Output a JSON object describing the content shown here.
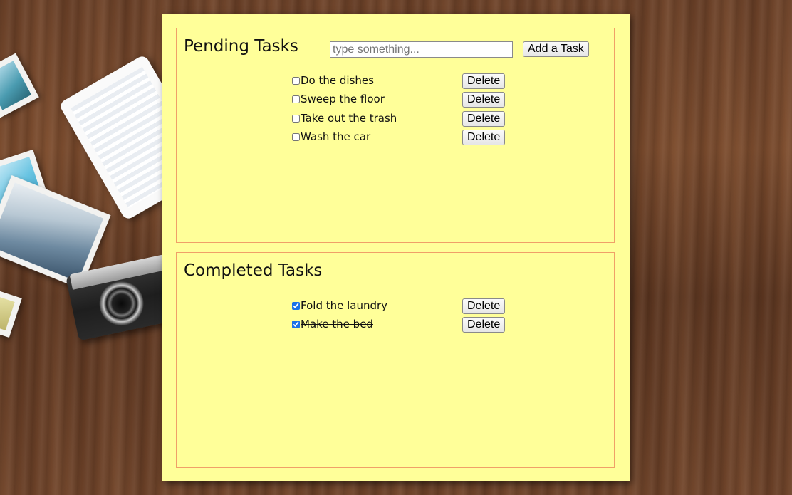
{
  "pending": {
    "title": "Pending Tasks",
    "input_placeholder": "type something...",
    "input_value": "",
    "add_button_label": "Add a Task",
    "tasks": [
      {
        "label": "Do the dishes",
        "checked": false,
        "delete_label": "Delete"
      },
      {
        "label": "Sweep the floor",
        "checked": false,
        "delete_label": "Delete"
      },
      {
        "label": "Take out the trash",
        "checked": false,
        "delete_label": "Delete"
      },
      {
        "label": "Wash the car",
        "checked": false,
        "delete_label": "Delete"
      }
    ]
  },
  "completed": {
    "title": "Completed Tasks",
    "tasks": [
      {
        "label": "Fold the laundry",
        "checked": true,
        "delete_label": "Delete"
      },
      {
        "label": "Make the bed",
        "checked": true,
        "delete_label": "Delete"
      }
    ]
  },
  "colors": {
    "note_background": "#ffff99",
    "panel_border": "#f0a068",
    "checkbox_accent": "#1a73e8"
  }
}
